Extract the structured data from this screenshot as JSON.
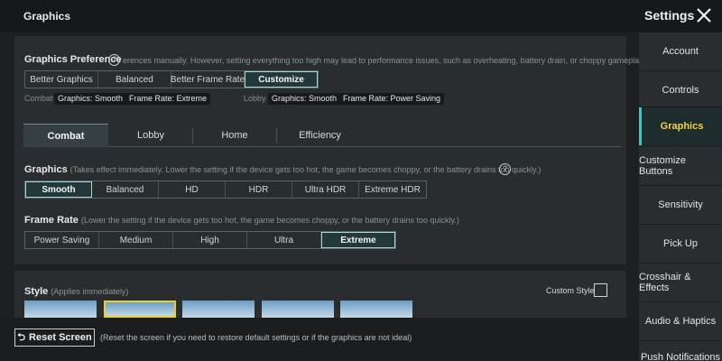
{
  "header": {
    "title": "Graphics",
    "settings_title": "Settings"
  },
  "preference": {
    "label": "Graphics Preference",
    "hint": "erences manually. However, setting everything too high may lead to performance issues, such as overheating, battery drain, or choppy gameplay.)",
    "options": [
      "Better Graphics",
      "Balanced",
      "Better Frame Rate",
      "Customize"
    ],
    "selected": "Customize",
    "combat_label": "Combat",
    "combat_chips": [
      "Graphics: Smooth",
      "Frame Rate: Extreme"
    ],
    "lobby_label": "Lobby",
    "lobby_chips": [
      "Graphics: Smooth",
      "Frame Rate: Power Saving"
    ]
  },
  "tabs": {
    "items": [
      "Combat",
      "Lobby",
      "Home",
      "Efficiency"
    ],
    "selected": "Combat"
  },
  "graphics": {
    "label": "Graphics",
    "hint": "(Takes effect immediately. Lower the setting if the device gets too hot, the game becomes choppy, or the battery drains too quickly.)",
    "options": [
      "Smooth",
      "Balanced",
      "HD",
      "HDR",
      "Ultra HDR",
      "Extreme HDR"
    ],
    "selected": "Smooth"
  },
  "frame_rate": {
    "label": "Frame Rate",
    "hint": "(Lower the setting if the device gets too hot, the game becomes choppy, or the battery drains too quickly.)",
    "options": [
      "Power Saving",
      "Medium",
      "High",
      "Ultra",
      "Extreme"
    ],
    "selected": "Extreme"
  },
  "style": {
    "label": "Style",
    "hint": "(Applies immediately)",
    "custom_label": "Custom Style",
    "selected_index": 1
  },
  "reset": {
    "label": "Reset Screen",
    "hint": "(Reset the screen if you need to restore default settings or if the graphics are not ideal)"
  },
  "sidebar": {
    "items": [
      "Account",
      "Controls",
      "Graphics",
      "Customize Buttons",
      "Sensitivity",
      "Pick Up",
      "Crosshair & Effects",
      "Audio & Haptics",
      "Push Notifications"
    ],
    "selected": "Graphics"
  },
  "colors": {
    "accent": "#f2d43a",
    "selected_border": "#a7d9d3",
    "teal": "#49c3c0"
  },
  "icons": {
    "close": "close-icon",
    "help": "help-icon",
    "reset": "reset-icon"
  }
}
